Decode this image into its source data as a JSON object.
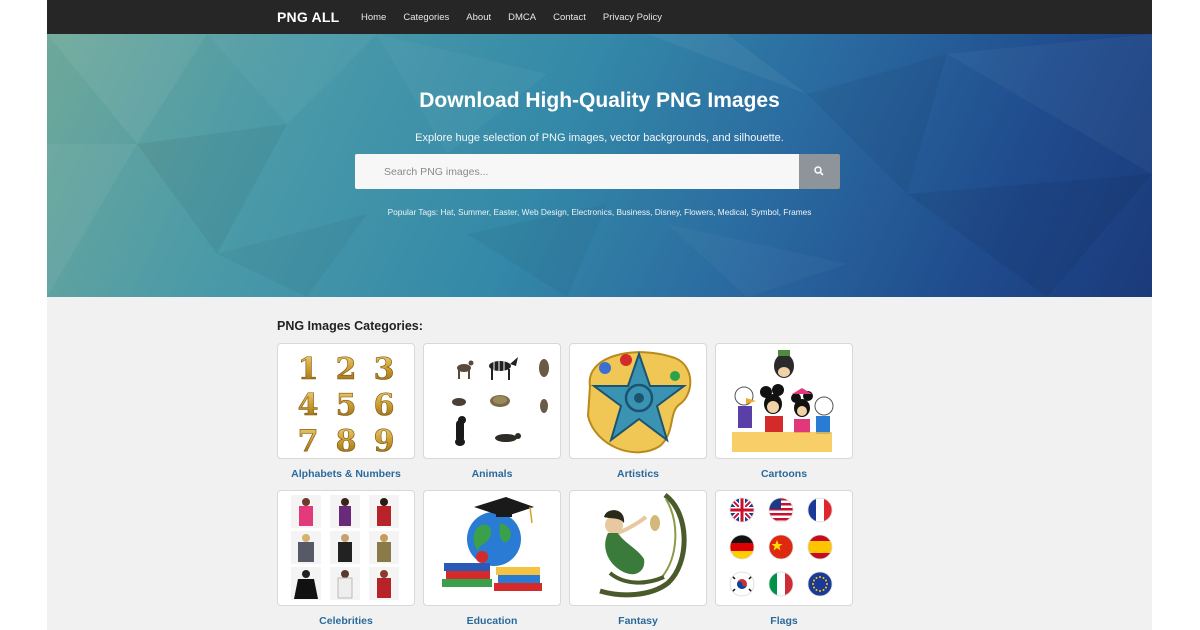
{
  "nav": {
    "brand": "PNG ALL",
    "links": [
      "Home",
      "Categories",
      "About",
      "DMCA",
      "Contact",
      "Privacy Policy"
    ]
  },
  "hero": {
    "title": "Download High-Quality PNG Images",
    "subtitle": "Explore huge selection of PNG images, vector backgrounds, and silhouette.",
    "search_placeholder": "Search PNG images...",
    "popular_tags_label": "Popular Tags:",
    "popular_tags": "Hat, Summer, Easter, Web Design, Electronics, Business, Disney, Flowers, Medical, Symbol, Frames"
  },
  "categories": {
    "heading": "PNG Images Categories:",
    "items": [
      {
        "label": "Alphabets & Numbers",
        "icon": "numbers-grid-image"
      },
      {
        "label": "Animals",
        "icon": "animals-collage-image"
      },
      {
        "label": "Artistics",
        "icon": "palette-star-image"
      },
      {
        "label": "Cartoons",
        "icon": "cartoon-characters-image"
      },
      {
        "label": "Celebrities",
        "icon": "celebrities-grid-image"
      },
      {
        "label": "Education",
        "icon": "globe-books-image"
      },
      {
        "label": "Fantasy",
        "icon": "fantasy-figure-image"
      },
      {
        "label": "Flags",
        "icon": "flags-grid-image"
      }
    ],
    "digits": [
      "1",
      "2",
      "3",
      "4",
      "5",
      "6",
      "7",
      "8",
      "9"
    ]
  },
  "colors": {
    "navbar": "#262626",
    "link_blue": "#2a6a9b",
    "search_button": "#8d949a"
  }
}
